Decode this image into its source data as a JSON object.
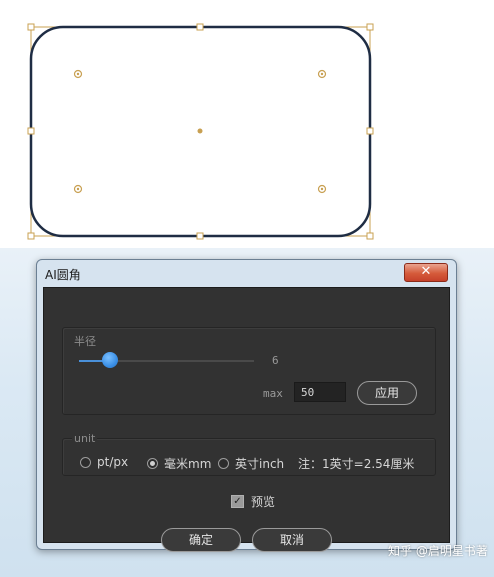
{
  "dialog": {
    "title": "AI圆角",
    "close_glyph": "✕",
    "radius_group": {
      "label": "半径",
      "slider_value": "6",
      "slider_fraction": 0.14,
      "max_label": "max",
      "max_value": "50",
      "apply_label": "应用"
    },
    "unit_group": {
      "label": "unit",
      "options": [
        {
          "label": "pt/px",
          "checked": false
        },
        {
          "label": "毫米mm",
          "checked": true
        },
        {
          "label": "英寸inch",
          "checked": false
        }
      ],
      "note": "注：1英寸=2.54厘米"
    },
    "preview": {
      "label": "预览",
      "checked": true
    },
    "ok_label": "确定",
    "cancel_label": "取消"
  },
  "watermark": "知乎 @启明星书著",
  "colors": {
    "selection": "#c8a052",
    "shape_stroke": "#1f2d44",
    "dialog_bg": "#323232",
    "slider_accent": "#3a8fe6"
  }
}
